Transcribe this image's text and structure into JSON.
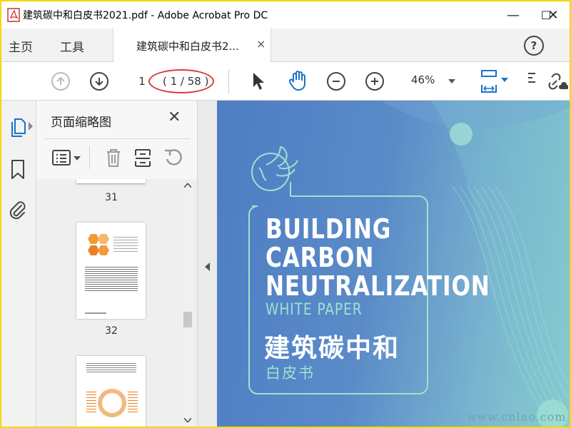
{
  "window": {
    "title": "建筑碳中和白皮书2021.pdf - Adobe Acrobat Pro DC",
    "minimize": "—",
    "maximize": "☐",
    "close": "✕"
  },
  "tabs": {
    "home": "主页",
    "tools": "工具",
    "document": "建筑碳中和白皮书2...",
    "document_close": "×",
    "help": "?"
  },
  "toolbar": {
    "current_page": "1",
    "page_count": "( 1 / 58 )",
    "zoom": "46%"
  },
  "panel": {
    "title": "页面缩略图",
    "close": "✕",
    "thumbnails": [
      {
        "label": "31"
      },
      {
        "label": "32"
      }
    ]
  },
  "cover": {
    "lines": [
      "BUILDING",
      "CARBON",
      "NEUTRALIZATION"
    ],
    "subtitle_en": "WHITE PAPER",
    "title_cn": "建筑碳中和",
    "subtitle_cn": "白皮书"
  },
  "watermark": "www.cnlao.com",
  "colors": {
    "frame": "#f5d800",
    "cover_blue": "#4e7dc3",
    "cover_teal": "#8ccfd0",
    "accent_green": "#9ee2cf",
    "annotation_red": "#d93a3a",
    "link_blue": "#1a73c9"
  },
  "icons": {
    "rail": [
      "pages-icon",
      "bookmark-icon",
      "attachment-icon"
    ],
    "toolbar": [
      "prev-page-icon",
      "next-page-icon",
      "select-cursor-icon",
      "hand-tool-icon",
      "zoom-out-icon",
      "zoom-in-icon",
      "fit-page-icon",
      "link-icon"
    ],
    "panel": [
      "thumbnail-options-icon",
      "delete-icon",
      "crop-icon",
      "rotate-icon"
    ]
  }
}
